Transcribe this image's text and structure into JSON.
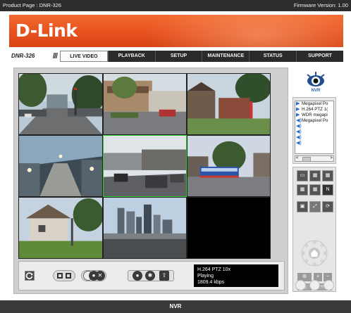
{
  "header": {
    "product_page": "Product Page : DNR-326",
    "firmware": "Firmware Version: 1.00"
  },
  "brand": {
    "logo_text": "D-Link"
  },
  "nav": {
    "model": "DNR-326",
    "tabs": [
      "LIVE VIDEO",
      "PLAYBACK",
      "SETUP",
      "MAINTENANCE",
      "STATUS",
      "SUPPORT"
    ],
    "active_tab": "LIVE VIDEO"
  },
  "side": {
    "logo_label": "NVR",
    "camera_list": [
      {
        "icon": "play-icon",
        "label": "Megapixel Po"
      },
      {
        "icon": "play-icon",
        "label": "H.264 PTZ 1("
      },
      {
        "icon": "play-icon",
        "label": "WDR megapi"
      },
      {
        "icon": "speaker-icon",
        "label": "Megapixel Po"
      },
      {
        "icon": "speaker-icon",
        "label": ""
      },
      {
        "icon": "speaker-icon",
        "label": ""
      },
      {
        "icon": "speaker-icon",
        "label": ""
      },
      {
        "icon": "speaker-icon",
        "label": ""
      }
    ],
    "scroll_left": "<",
    "scroll_right": ">",
    "layout_n_label": "N"
  },
  "player": {
    "camera_name": "H.264 PTZ 10x",
    "status": "Playing",
    "bitrate": "1809.4 kbps"
  },
  "footer": {
    "label": "NVR"
  },
  "colors": {
    "banner_orange": "#e7521f",
    "selected_border": "#2ad22a",
    "list_icon_blue": "#1e6ec8"
  }
}
